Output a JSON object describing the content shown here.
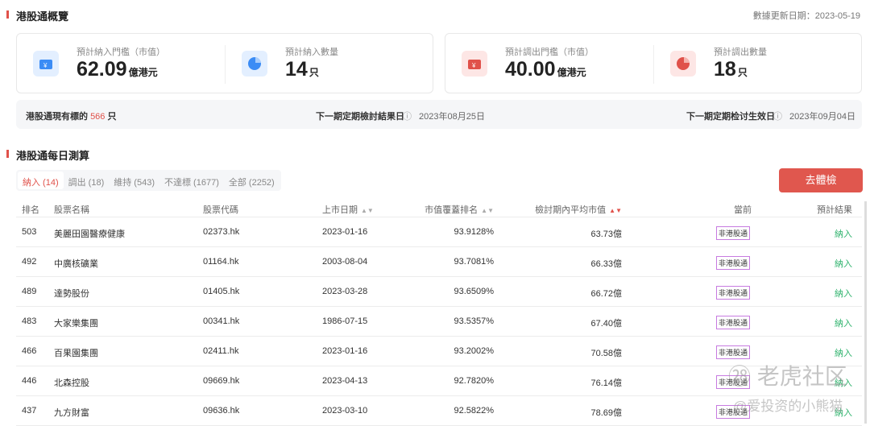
{
  "overview": {
    "title": "港股通概覽",
    "update_label": "數據更新日期：2023-05-19",
    "in_threshold": {
      "label": "預計納入門檻（市值）",
      "value": "62.09",
      "unit": "億港元",
      "icon": "wallet-icon"
    },
    "in_count": {
      "label": "預計納入數量",
      "value": "14",
      "unit": "只",
      "icon": "pie-chart-icon"
    },
    "out_threshold": {
      "label": "預計調出門檻（市值）",
      "value": "40.00",
      "unit": "億港元",
      "icon": "wallet-icon"
    },
    "out_count": {
      "label": "預計調出數量",
      "value": "18",
      "unit": "只",
      "icon": "pie-chart-icon"
    },
    "current_label": "港股通現有標的",
    "current_count": "566",
    "current_unit": "只",
    "review_label": "下一期定期檢討結果日",
    "review_date": "2023年08月25日",
    "effective_label": "下一期定期检讨生效日",
    "effective_date": "2023年09月04日",
    "blue": "#3b8cf5",
    "red": "#e0514a"
  },
  "daily": {
    "title": "港股通每日測算",
    "button": "去體檢",
    "tabs": [
      {
        "label": "納入 (14)"
      },
      {
        "label": "調出 (18)"
      },
      {
        "label": "維持 (543)"
      },
      {
        "label": "不達標 (1677)"
      },
      {
        "label": "全部 (2252)"
      }
    ],
    "columns": [
      "排名",
      "股票名稱",
      "股票代碼",
      "上市日期",
      "市值覆蓋排名",
      "檢討期內平均市值",
      "當前",
      "預計結果"
    ],
    "rows": [
      {
        "rank": "503",
        "name": "美麗田園醫療健康",
        "code": "02373.hk",
        "date": "2023-01-16",
        "cov": "93.9128%",
        "avg": "63.73億",
        "cur": "非港股通",
        "res": "納入"
      },
      {
        "rank": "492",
        "name": "中廣核礦業",
        "code": "01164.hk",
        "date": "2003-08-04",
        "cov": "93.7081%",
        "avg": "66.33億",
        "cur": "非港股通",
        "res": "納入"
      },
      {
        "rank": "489",
        "name": "達勢股份",
        "code": "01405.hk",
        "date": "2023-03-28",
        "cov": "93.6509%",
        "avg": "66.72億",
        "cur": "非港股通",
        "res": "納入"
      },
      {
        "rank": "483",
        "name": "大家樂集團",
        "code": "00341.hk",
        "date": "1986-07-15",
        "cov": "93.5357%",
        "avg": "67.40億",
        "cur": "非港股通",
        "res": "納入"
      },
      {
        "rank": "466",
        "name": "百果園集團",
        "code": "02411.hk",
        "date": "2023-01-16",
        "cov": "93.2002%",
        "avg": "70.58億",
        "cur": "非港股通",
        "res": "納入"
      },
      {
        "rank": "446",
        "name": "北森控股",
        "code": "09669.hk",
        "date": "2023-04-13",
        "cov": "92.7820%",
        "avg": "76.14億",
        "cur": "非港股通",
        "res": "納入"
      },
      {
        "rank": "437",
        "name": "九方財富",
        "code": "09636.hk",
        "date": "2023-03-10",
        "cov": "92.5822%",
        "avg": "78.69億",
        "cur": "非港股通",
        "res": "納入"
      }
    ]
  },
  "watermark": {
    "brand": "老虎社区",
    "user": "@爱投资的小熊猫"
  }
}
